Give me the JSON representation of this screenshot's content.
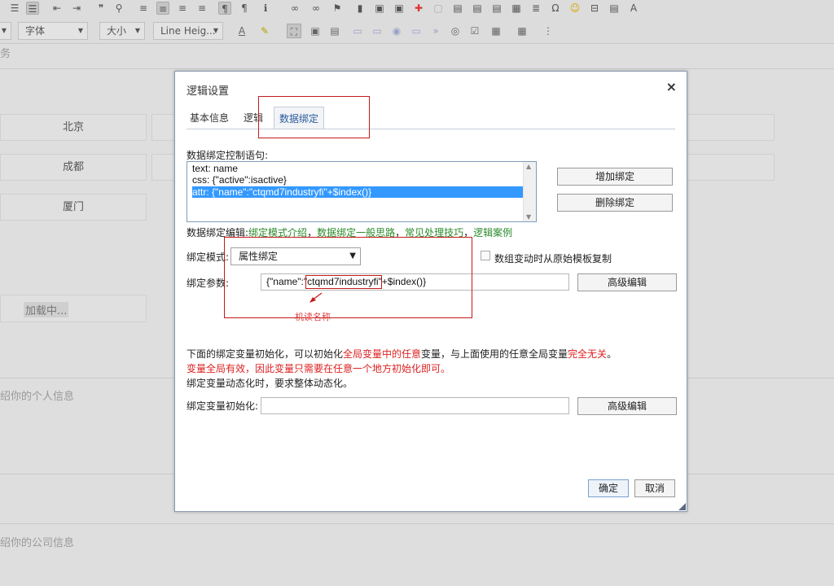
{
  "toolbar": {
    "font_label": "字体",
    "size_label": "大小",
    "line_height_label": "Line Heig..."
  },
  "background": {
    "partial_label": "务",
    "cities": [
      "北京",
      "成都",
      "厦门"
    ],
    "loading": "加载中...",
    "personal_placeholder": "绍你的个人信息",
    "company_placeholder": "绍你的公司信息"
  },
  "dialog": {
    "title": "逻辑设置",
    "close": "×",
    "tabs": [
      "基本信息",
      "逻辑",
      "数据绑定"
    ],
    "active_tab": "数据绑定",
    "control_label": "数据绑定控制语句:",
    "statements": [
      "text: name",
      "css: {\"active\":isactive}",
      "attr: {\"name\":\"ctqmd7industryfi\"+$index()}"
    ],
    "add_binding": "增加绑定",
    "delete_binding": "删除绑定",
    "edit_label": "数据绑定编辑:",
    "links": [
      "绑定模式介绍",
      "数据绑定一般思路",
      "常见处理技巧",
      "逻辑案例"
    ],
    "link_separator": "，",
    "mode_label": "绑定模式:",
    "mode_value": "属性绑定",
    "copy_checkbox_label": "数组变动时从原始模板复制",
    "param_label": "绑定参数:",
    "param_value": "{\"name\":\"ctqmd7industryfi\"+$index()}",
    "advanced_edit": "高级编辑",
    "annotation": "机读名称",
    "info": {
      "line1_a": "下面的绑定变量初始化，可以初始化",
      "line1_b": "全局变量中的任意",
      "line1_c": "变量，与上面使用的任意全局变量",
      "line1_d": "完全无关",
      "line1_e": "。",
      "line2": "变量全局有效，因此变量只需要在任意一个地方初始化即可。",
      "line3": "绑定变量动态化时，要求整体动态化。"
    },
    "init_label": "绑定变量初始化:",
    "init_value": "",
    "ok": "确定",
    "cancel": "取消"
  },
  "colors": {
    "accent": "#2a5a9a",
    "link": "#2a8a2a",
    "annotation": "#c41a1a",
    "warning": "#dd2222",
    "selection": "#3399ff"
  }
}
